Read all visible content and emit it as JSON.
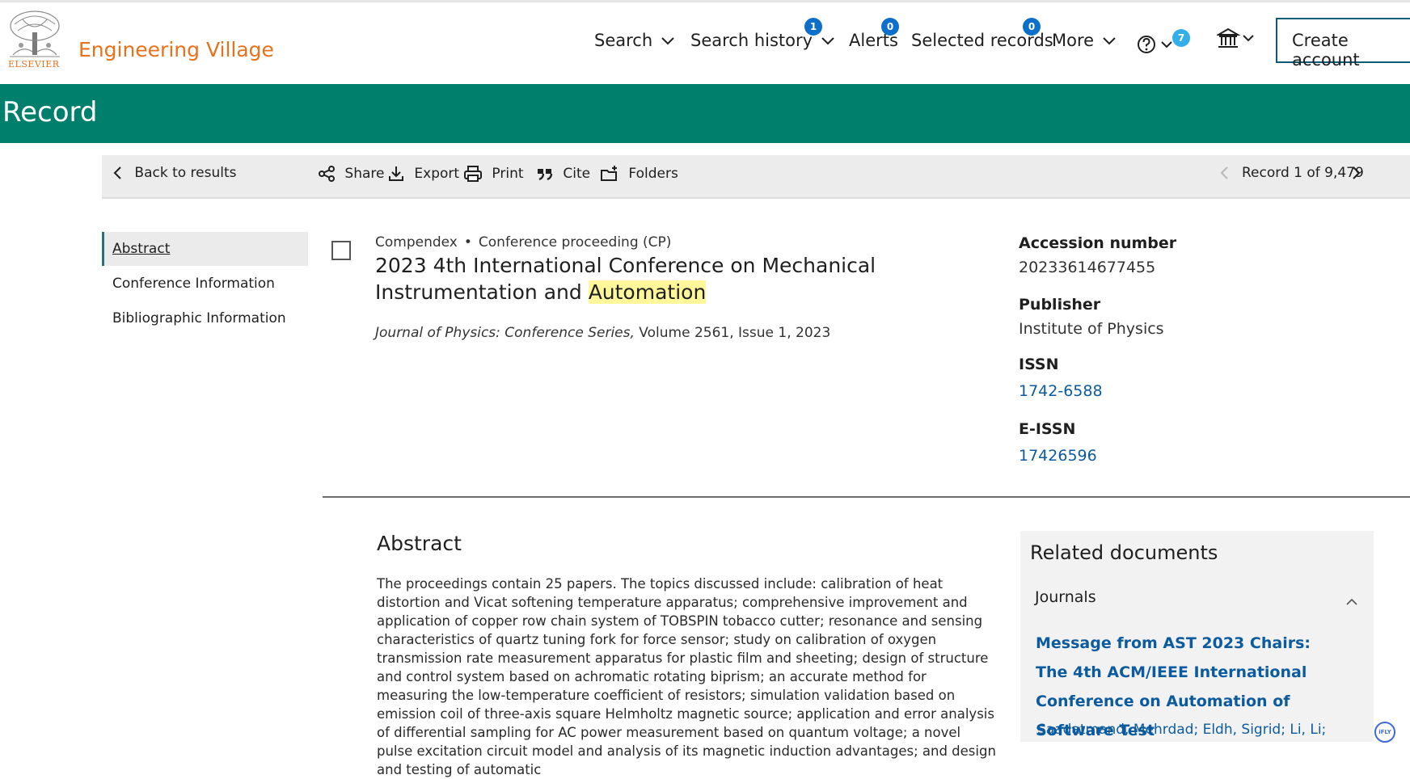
{
  "header": {
    "logo_text": "ELSEVIER",
    "brand": "Engineering Village",
    "nav": {
      "search": "Search",
      "search_history": "Search history",
      "search_history_badge": "1",
      "alerts": "Alerts",
      "alerts_badge": "0",
      "selected_records": "Selected records",
      "selected_records_badge": "0",
      "more": "More",
      "help_badge": "7"
    },
    "create_account": "Create account"
  },
  "banner": {
    "title": "Record"
  },
  "toolbar": {
    "back": "Back to results",
    "share": "Share",
    "export": "Export",
    "print": "Print",
    "cite": "Cite",
    "folders": "Folders",
    "record_position": "Record 1 of 9,479"
  },
  "sidenav": {
    "items": [
      "Abstract",
      "Conference Information",
      "Bibliographic Information"
    ]
  },
  "record": {
    "database": "Compendex",
    "doc_type": "Conference proceeding (CP)",
    "title_part1": "2023 4th International Conference on Mechanical Instrumentation and ",
    "title_highlight": "Automation",
    "source_journal": "Journal of Physics: Conference Series,",
    "source_details": " Volume 2561, Issue 1, 2023"
  },
  "metadata": {
    "accession_label": "Accession number",
    "accession_value": "20233614677455",
    "publisher_label": "Publisher",
    "publisher_value": "Institute of Physics",
    "issn_label": "ISSN",
    "issn_value": "1742-6588",
    "eissn_label": "E-ISSN",
    "eissn_value": "17426596"
  },
  "abstract": {
    "heading": "Abstract",
    "text": "The proceedings contain 25 papers. The topics discussed include: calibration of heat distortion and Vicat softening temperature apparatus; comprehensive improvement and application of copper row chain system of TOBSPIN tobacco cutter; resonance and sensing characteristics of quartz tuning fork for force sensor; study on calibration of oxygen transmission rate measurement apparatus for plastic film and sheeting; design of structure and control system based on achromatic rotating biprism; an accurate method for measuring the low-temperature coefficient of resistors; simulation validation based on emission coil of three-axis square Helmholtz magnetic source; application and error analysis of differential sampling for AC power measurement based on quantum voltage; a novel pulse excitation circuit model and analysis of its magnetic induction advantages; and design and testing of automatic"
  },
  "related": {
    "title": "Related documents",
    "section": "Journals",
    "doc_title": "Message from AST 2023 Chairs: The 4th ACM/IEEE International Conference on Automation of Software Test",
    "authors": "Saadatmand, Mehrdad; Eldh, Sigrid;   Li, Li;"
  },
  "widget": {
    "label": "iFLY"
  }
}
